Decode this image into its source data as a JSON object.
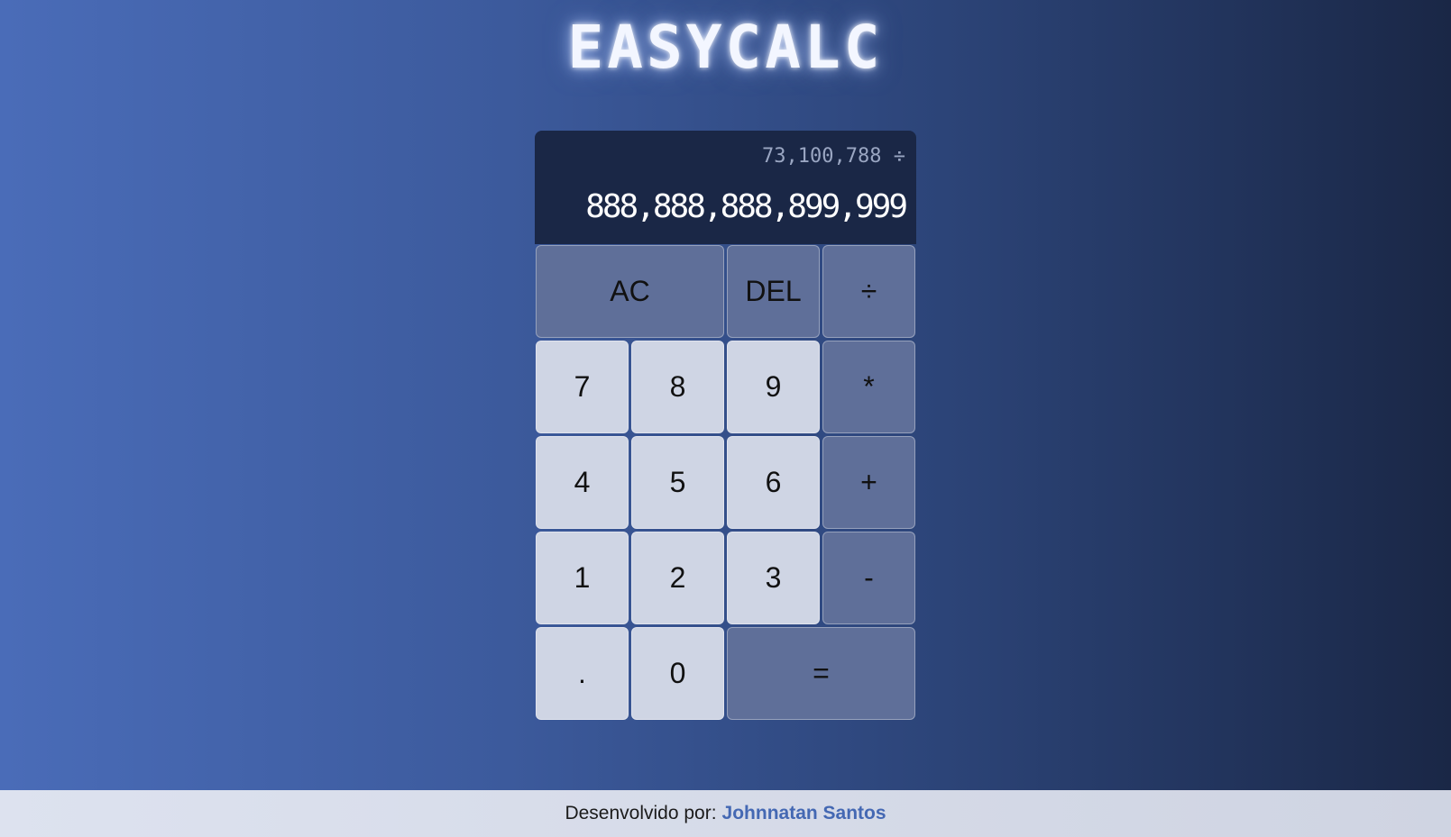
{
  "app": {
    "title": "EASYCALC"
  },
  "display": {
    "previous_operand": "73,100,788 ÷",
    "current_operand": "888,888,888,899,999"
  },
  "keys": {
    "ac": "AC",
    "del": "DEL",
    "divide": "÷",
    "seven": "7",
    "eight": "8",
    "nine": "9",
    "multiply": "*",
    "four": "4",
    "five": "5",
    "six": "6",
    "plus": "+",
    "one": "1",
    "two": "2",
    "three": "3",
    "minus": "-",
    "dot": ".",
    "zero": "0",
    "equals": "="
  },
  "footer": {
    "prefix": "Desenvolvido por:",
    "author": "Johnnatan Santos"
  },
  "colors": {
    "display_bg": "#1a2746",
    "number_key_bg": "#cfd5e4",
    "operator_key_bg": "#5f6f99",
    "author_link": "#4468b3"
  }
}
